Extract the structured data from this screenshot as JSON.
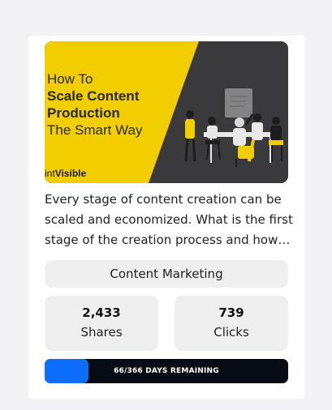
{
  "thumbnail": {
    "headline_line1": "How To",
    "headline_line2": "Scale Content",
    "headline_line3": "Production",
    "headline_line4": "The Smart Way",
    "brand_prefix": "int",
    "brand_bold": "Visible",
    "colors": {
      "yellow": "#f2cd00",
      "dark": "#3a3a3c"
    }
  },
  "description": "Every stage of content creation can be scaled and economized. What is the first stage of the creation process and how…",
  "category": "Content Marketing",
  "stats": {
    "shares_value": "2,433",
    "shares_label": "Shares",
    "clicks_value": "739",
    "clicks_label": "Clicks"
  },
  "progress": {
    "text": "66/366 DAYS REMAINING",
    "fraction": 0.18,
    "fill_color": "#0d6efd",
    "track_color": "#070b14"
  }
}
